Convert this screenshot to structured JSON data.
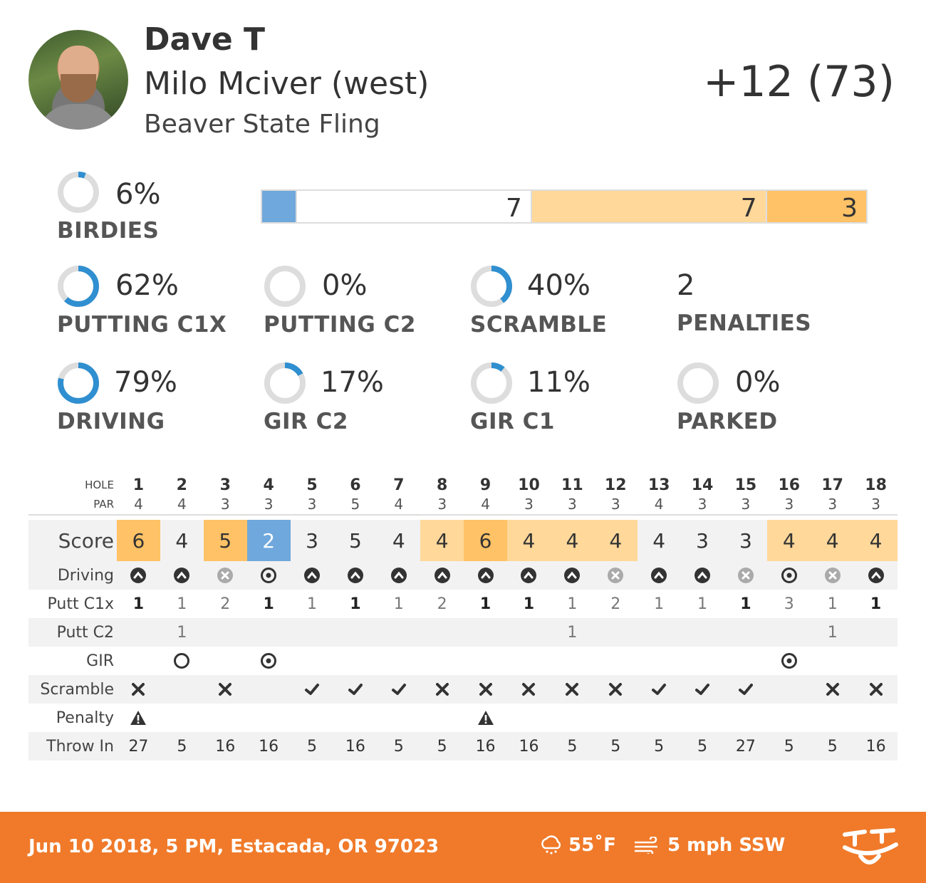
{
  "header": {
    "player_name": "Dave T",
    "course_name": "Milo Mciver (west)",
    "event_name": "Beaver State Fling",
    "total_score": "+12 (73)"
  },
  "stats": {
    "birdies": {
      "value": "6%",
      "label": "BIRDIES",
      "fraction": 0.06
    },
    "putting_c1x": {
      "value": "62%",
      "label": "PUTTING C1X",
      "fraction": 0.62
    },
    "putting_c2": {
      "value": "0%",
      "label": "PUTTING C2",
      "fraction": 0.0
    },
    "scramble": {
      "value": "40%",
      "label": "SCRAMBLE",
      "fraction": 0.4
    },
    "penalties": {
      "value": "2",
      "label": "PENALTIES"
    },
    "driving": {
      "value": "79%",
      "label": "DRIVING",
      "fraction": 0.79
    },
    "gir_c2": {
      "value": "17%",
      "label": "GIR C2",
      "fraction": 0.17
    },
    "gir_c1": {
      "value": "11%",
      "label": "GIR C1",
      "fraction": 0.11
    },
    "parked": {
      "value": "0%",
      "label": "PARKED",
      "fraction": 0.0
    }
  },
  "score_distribution": {
    "segments": [
      {
        "label": "",
        "count": 1,
        "color": "#6fa8dc"
      },
      {
        "label": "7",
        "count": 7,
        "color": "#ffffff"
      },
      {
        "label": "7",
        "count": 7,
        "color": "#ffd89a"
      },
      {
        "label": "3",
        "count": 3,
        "color": "#ffc266"
      }
    ]
  },
  "colors": {
    "accent_blue": "#2f8fd0",
    "ring_bg": "#dddddd",
    "birdie": "#6fa8dc",
    "bogey": "#ffd89a",
    "double_bogey": "#ffc266",
    "footer": "#f07a2a"
  },
  "scorecard": {
    "labels": {
      "hole": "HOLE",
      "par": "PAR",
      "score": "Score",
      "driving": "Driving",
      "putt_c1x": "Putt C1x",
      "putt_c2": "Putt C2",
      "gir": "GIR",
      "scramble": "Scramble",
      "penalty": "Penalty",
      "throw_in": "Throw In"
    },
    "holes": [
      "1",
      "2",
      "3",
      "4",
      "5",
      "6",
      "7",
      "8",
      "9",
      "10",
      "11",
      "12",
      "13",
      "14",
      "15",
      "16",
      "17",
      "18"
    ],
    "par": [
      "4",
      "4",
      "3",
      "3",
      "3",
      "5",
      "4",
      "3",
      "4",
      "3",
      "3",
      "3",
      "4",
      "3",
      "3",
      "3",
      "3",
      "3"
    ],
    "score": [
      "6",
      "4",
      "5",
      "2",
      "3",
      "5",
      "4",
      "4",
      "6",
      "4",
      "4",
      "4",
      "4",
      "3",
      "3",
      "4",
      "4",
      "4"
    ],
    "driving": [
      "fairway",
      "fairway",
      "miss",
      "target",
      "fairway",
      "fairway",
      "fairway",
      "fairway",
      "fairway",
      "fairway",
      "fairway",
      "miss",
      "fairway",
      "fairway",
      "miss",
      "target",
      "miss",
      "fairway"
    ],
    "putt_c1x": [
      "1",
      "1",
      "2",
      "1",
      "1",
      "1",
      "1",
      "2",
      "1",
      "1",
      "1",
      "2",
      "1",
      "1",
      "1",
      "3",
      "1",
      "1"
    ],
    "putt_c1x_made": [
      true,
      false,
      false,
      true,
      false,
      true,
      false,
      false,
      true,
      true,
      false,
      false,
      false,
      false,
      true,
      false,
      false,
      true
    ],
    "putt_c2": [
      "",
      "1",
      "",
      "",
      "",
      "",
      "",
      "",
      "",
      "",
      "1",
      "",
      "",
      "",
      "",
      "",
      "1",
      ""
    ],
    "gir": [
      "",
      "c2",
      "",
      "c1",
      "",
      "",
      "",
      "",
      "",
      "",
      "",
      "",
      "",
      "",
      "",
      "c1",
      "",
      ""
    ],
    "scramble": [
      "x",
      "",
      "x",
      "",
      "check",
      "check",
      "check",
      "x",
      "x",
      "x",
      "x",
      "x",
      "check",
      "check",
      "check",
      "",
      "x",
      "x"
    ],
    "penalty": [
      "warn",
      "",
      "",
      "",
      "",
      "",
      "",
      "",
      "warn",
      "",
      "",
      "",
      "",
      "",
      "",
      "",
      "",
      ""
    ],
    "throw_in": [
      "27",
      "5",
      "16",
      "16",
      "5",
      "16",
      "5",
      "5",
      "16",
      "16",
      "5",
      "5",
      "5",
      "5",
      "27",
      "5",
      "5",
      "16"
    ]
  },
  "footer": {
    "date_location": "Jun 10 2018, 5 PM, Estacada, OR 97023",
    "temperature": "55˚F",
    "wind": "5 mph SSW"
  }
}
